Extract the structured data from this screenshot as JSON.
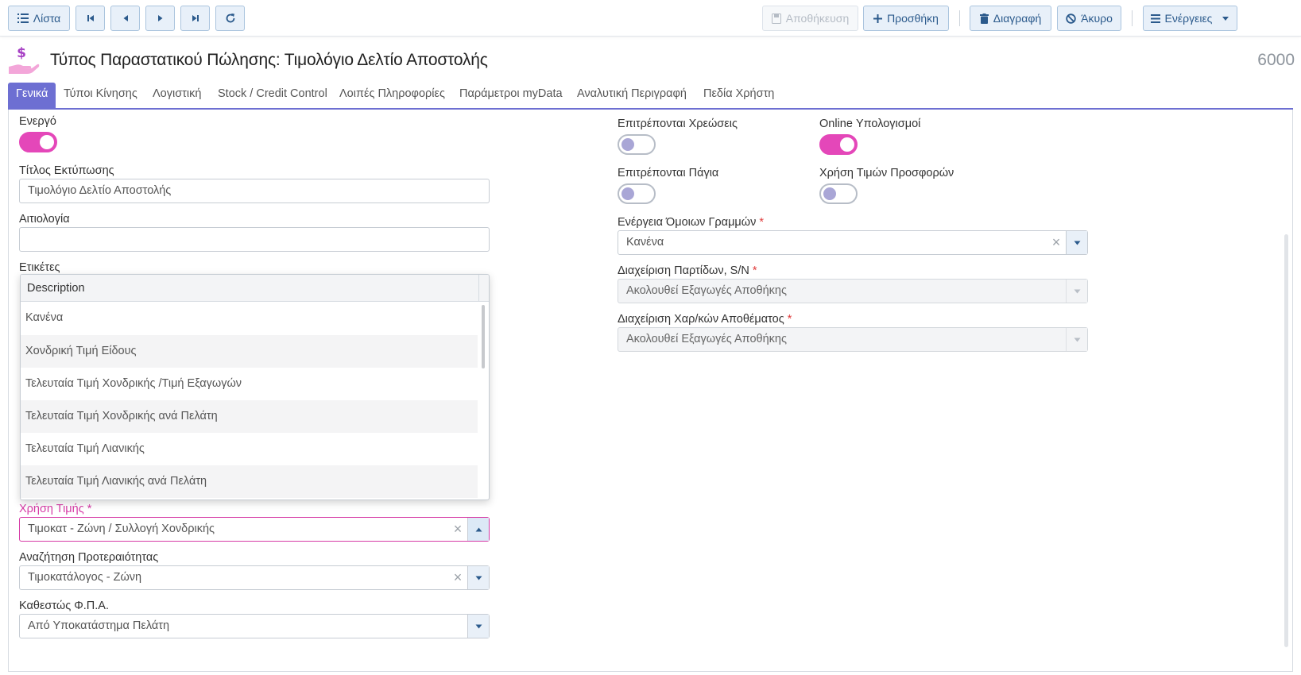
{
  "toolbar": {
    "list_label": "Λίστα",
    "save_label": "Αποθήκευση",
    "add_label": "Προσθήκη",
    "delete_label": "Διαγραφή",
    "cancel_label": "Άκυρο",
    "actions_label": "Ενέργειες"
  },
  "header": {
    "title": "Τύπος Παραστατικού Πώλησης: Τιμολόγιο Δελτίο Αποστολής",
    "record_id": "6000",
    "icon": "hand-dollar-icon"
  },
  "tabs": [
    {
      "label": "Γενικά",
      "active": true
    },
    {
      "label": "Τύποι Κίνησης"
    },
    {
      "label": "Λογιστική"
    },
    {
      "label": "Stock / Credit Control"
    },
    {
      "label": "Λοιπές Πληροφορίες"
    },
    {
      "label": "Παράμετροι myData"
    },
    {
      "label": "Αναλυτική Περιγραφή"
    },
    {
      "label": "Πεδία Χρήστη"
    }
  ],
  "form": {
    "active": {
      "label": "Ενεργό",
      "value": true
    },
    "print_title": {
      "label": "Τίτλος Εκτύπωσης",
      "placeholder": "Τιμολόγιο Δελτίο Αποστολής"
    },
    "reason": {
      "label": "Αιτιολογία",
      "value": ""
    },
    "tags": {
      "label": "Ετικέτες"
    },
    "price_usage": {
      "label": "Χρήση Τιμής",
      "value": "Τιμοκατ - Ζώνη / Συλλογή Χονδρικής"
    },
    "priority_search": {
      "label": "Αναζήτηση Προτεραιότητας",
      "value": "Τιμοκατάλογος - Ζώνη"
    },
    "vat_status": {
      "label": "Καθεστώς Φ.Π.Α.",
      "value": "Από Υποκατάστημα Πελάτη"
    },
    "allow_charges": {
      "label": "Επιτρέπονται Χρεώσεις",
      "value": false
    },
    "online_calc": {
      "label": "Online Υπολογισμοί",
      "value": true
    },
    "allow_assets": {
      "label": "Επιτρέπονται Πάγια",
      "value": false
    },
    "use_offer_prices": {
      "label": "Χρήση Τιμών Προσφορών",
      "value": false
    },
    "similar_lines": {
      "label": "Ενέργεια Όμοιων Γραμμών",
      "value": "Κανένα"
    },
    "batch_sn": {
      "label": "Διαχείριση Παρτίδων, S/N",
      "value": "Ακολουθεί Εξαγωγές Αποθήκης"
    },
    "stock_chars": {
      "label": "Διαχείριση Χαρ/κών Αποθέματος",
      "value": "Ακολουθεί Εξαγωγές Αποθήκης"
    },
    "required_mark": "*"
  },
  "dropdown": {
    "header": "Description",
    "options": [
      "Κανένα",
      "Χονδρική Τιμή Είδους",
      "Τελευταία Τιμή Χονδρικής /Τιμή Εξαγωγών",
      "Τελευταία Τιμή Χονδρικής ανά Πελάτη",
      "Τελευταία Τιμή Λιανικής",
      "Τελευταία Τιμή Λιανικής ανά Πελάτη"
    ]
  },
  "colors": {
    "accent": "#6d6fd2",
    "toggle_on": "#e447b9",
    "invalid": "#d63ba6",
    "required": "#e03c3c"
  }
}
